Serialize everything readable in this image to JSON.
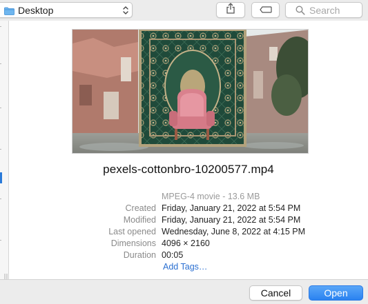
{
  "toolbar": {
    "location": "Desktop",
    "search_placeholder": "Search"
  },
  "preview": {
    "filename": "pexels-cottonbro-10200577.mp4",
    "kind": "MPEG-4 movie - 13.6 MB",
    "fields": [
      {
        "label": "Created",
        "value": "Friday, January 21, 2022 at 5:54 PM"
      },
      {
        "label": "Modified",
        "value": "Friday, January 21, 2022 at 5:54 PM"
      },
      {
        "label": "Last opened",
        "value": "Wednesday, June 8, 2022 at 4:15 PM"
      },
      {
        "label": "Dimensions",
        "value": "4096 × 2160"
      },
      {
        "label": "Duration",
        "value": "00:05"
      }
    ],
    "add_tags": "Add Tags…"
  },
  "buttons": {
    "cancel": "Cancel",
    "open": "Open"
  },
  "colors": {
    "accent": "#2a82f0",
    "link": "#2a6fd1"
  }
}
